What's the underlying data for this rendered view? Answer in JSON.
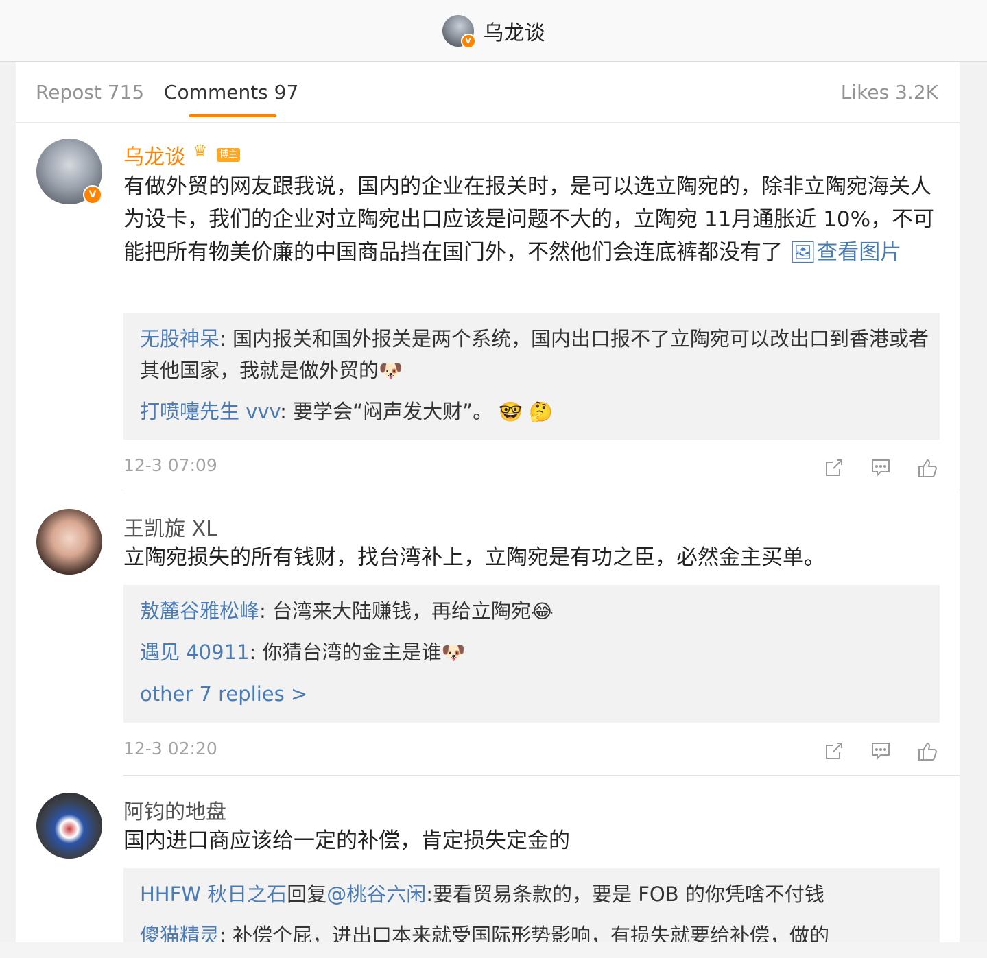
{
  "header": {
    "title": "乌龙谈",
    "verified_mark": "V"
  },
  "tabs": {
    "repost": "Repost 715",
    "comments": "Comments 97",
    "likes": "Likes 3.2K"
  },
  "colors": {
    "accent": "#ff8200",
    "link": "#4a7bb5"
  },
  "comments": [
    {
      "user": "乌龙谈",
      "is_author": true,
      "verified_mark": "V",
      "blogger_badge": "博主",
      "text": "有做外贸的网友跟我说，国内的企业在报关时，是可以选立陶宛的，除非立陶宛海关人为设卡，我们的企业对立陶宛出口应该是问题不大的，立陶宛 11月通胀近 10%，不可能把所有物美价廉的中国商品挡在国门外，不然他们会连底裤都没有了",
      "image_link": "🖼查看图片",
      "replies": [
        {
          "name": "无股神呆",
          "text": ": 国内报关和国外报关是两个系统，国内出口报不了立陶宛可以改出口到香港或者其他国家，我就是做外贸的",
          "emoji": "🐶"
        },
        {
          "name": "打喷嚏先生 vvv",
          "text": ": 要学会“闷声发大财”。",
          "emoji": "🤓 🤔"
        }
      ],
      "time": "12-3 07:09"
    },
    {
      "user": "王凯旋 XL",
      "is_author": false,
      "text": "立陶宛损失的所有钱财，找台湾补上，立陶宛是有功之臣，必然金主买单。",
      "replies": [
        {
          "name": "敖麓谷雅松峰",
          "text": ": 台湾来大陆赚钱，再给立陶宛",
          "emoji": "😂"
        },
        {
          "name": "遇见 40911",
          "text": ": 你猜台湾的金主是谁",
          "emoji": "🐶"
        }
      ],
      "more_replies": "other 7 replies >",
      "time": "12-3 02:20"
    },
    {
      "user": "阿钧的地盘",
      "is_author": false,
      "text": "国内进口商应该给一定的补偿，肯定损失定金的",
      "replies": [
        {
          "name": "HHFW 秋日之石",
          "text_mid": "回复",
          "mention": "@桃谷六闲",
          "text": ":要看贸易条款的，要是 FOB 的你凭啥不付钱"
        },
        {
          "name": "傻猫精灵",
          "text": ": 补偿个屁，进出口本来就受国际形势影响，有损失就要给补偿，做的"
        }
      ]
    }
  ]
}
